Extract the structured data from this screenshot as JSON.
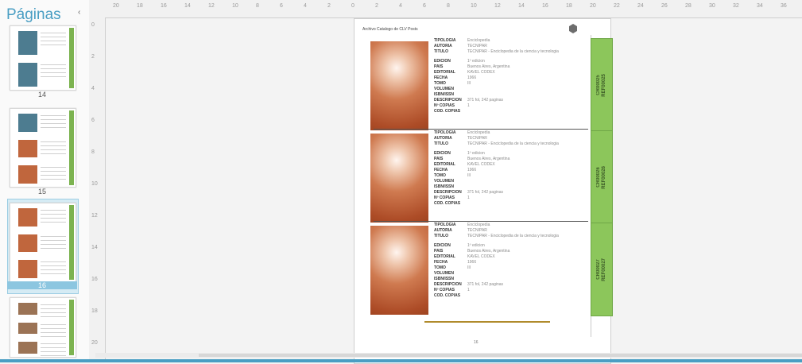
{
  "panel": {
    "title": "Páginas",
    "collapse_icon": "chevron-left-icon",
    "thumbnails": [
      {
        "label": "14",
        "style": "blue"
      },
      {
        "label": "15",
        "style": "mixed"
      },
      {
        "label": "16",
        "style": "copper",
        "selected": true
      },
      {
        "label": "",
        "style": "brown"
      }
    ]
  },
  "rulers": {
    "top": [
      "20",
      "18",
      "16",
      "14",
      "12",
      "10",
      "8",
      "6",
      "4",
      "2",
      "0",
      "2",
      "4",
      "6",
      "8",
      "10",
      "12",
      "14",
      "16",
      "18",
      "20",
      "22",
      "24",
      "26",
      "28",
      "30",
      "32",
      "34",
      "36"
    ],
    "left": [
      "0",
      "2",
      "4",
      "6",
      "8",
      "10",
      "12",
      "14",
      "16",
      "18",
      "20"
    ]
  },
  "page": {
    "header": "Archivo Catalogo de CLV Posts",
    "footer": "16",
    "field_labels": [
      "TIPOLOGIA",
      "AUTORIA",
      "TITULO",
      "EDICION",
      "PAIS",
      "EDITORIAL",
      "FECHA",
      "TOMO",
      "VOLUMEN",
      "ISBN/ISSN",
      "DESCRIPCION",
      "Nº COPIAS",
      "COD. COPIAS"
    ],
    "records": [
      {
        "tab": "CR00025\nREF00025",
        "values": [
          "Enciclopedia",
          "TECNIPAR",
          "TECNIPAR - Enciclopedia de la ciencia y tecnologia",
          "1º edicion",
          "Buenos Aires, Argentina",
          "KAVEL CODEX",
          "1966",
          "III",
          "",
          "",
          "371 fol, 242 paginas",
          "1",
          ""
        ]
      },
      {
        "tab": "CR00026\nREF00026",
        "values": [
          "Enciclopedia",
          "TECNIPAR",
          "TECNIPAR - Enciclopedia de la ciencia y tecnologia",
          "1º edicion",
          "Buenos Aires, Argentina",
          "KAVEL CODEX",
          "1966",
          "III",
          "",
          "",
          "371 fol, 242 paginas",
          "1",
          ""
        ]
      },
      {
        "tab": "CR00027\nREF00027",
        "values": [
          "Enciclopedia",
          "TECNIPAR",
          "TECNIPAR - Enciclopedia de la ciencia y tecnologia",
          "1º edicion",
          "Buenos Aires, Argentina",
          "KAVEL CODEX",
          "1966",
          "III",
          "",
          "",
          "371 fol, 242 paginas",
          "1",
          ""
        ]
      }
    ]
  },
  "colors": {
    "accent": "#4a9ec3",
    "tab_green": "#8cc65b",
    "cover_copper": "#c0663d"
  }
}
